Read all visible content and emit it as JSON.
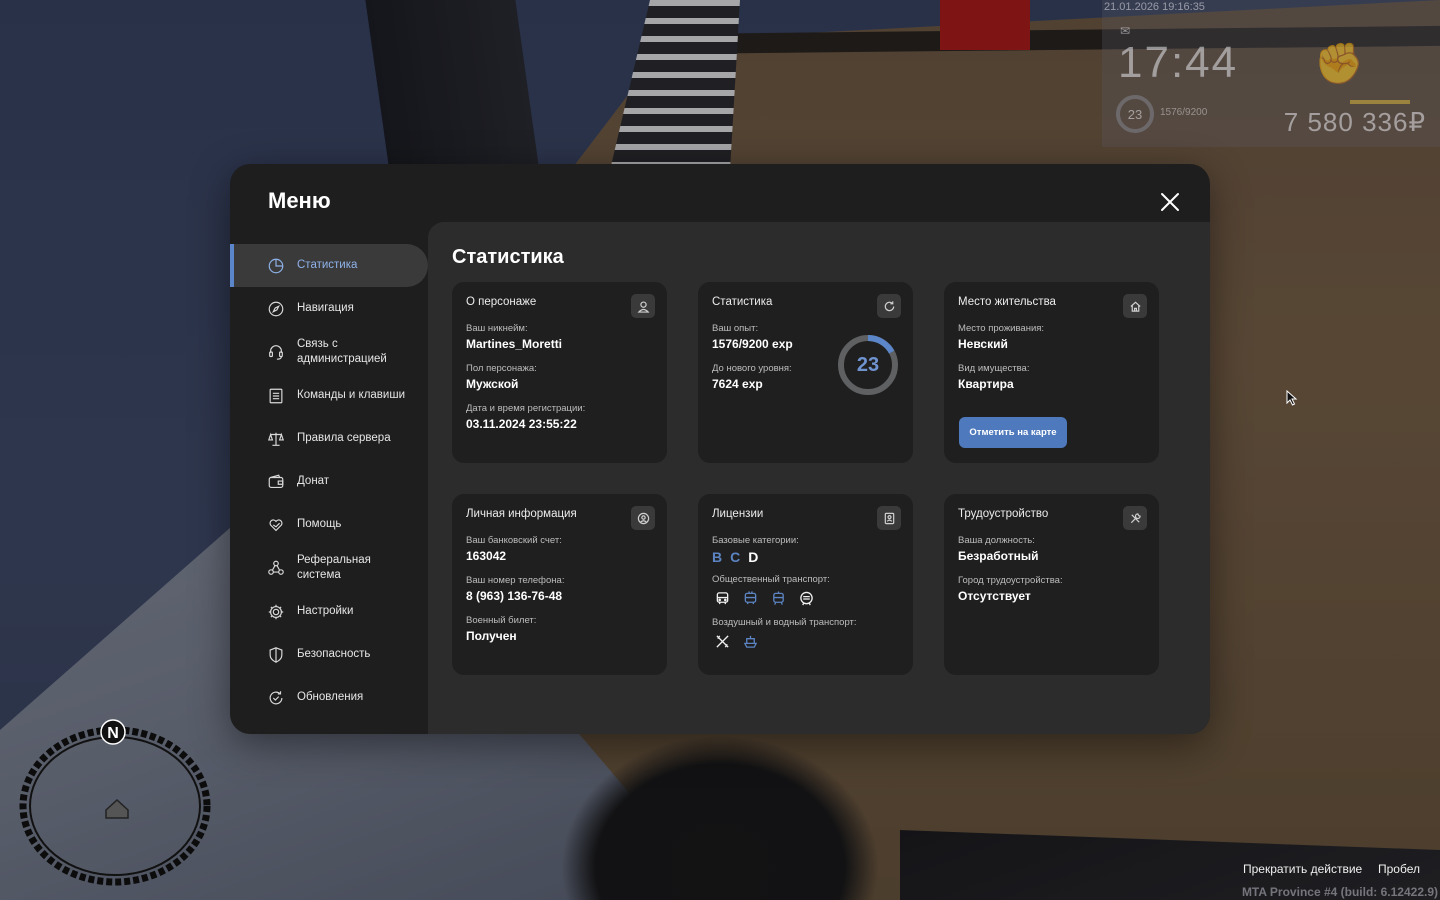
{
  "hud": {
    "datetime": "21.01.2026 19:16:35",
    "clock": "17:44",
    "level": "23",
    "exp": "1576/9200",
    "money": "7 580 336₽"
  },
  "menu": {
    "title": "Меню",
    "sidebar": [
      {
        "label": "Статистика",
        "icon": "chart-pie-icon",
        "active": true
      },
      {
        "label": "Навигация",
        "icon": "compass-icon"
      },
      {
        "label": "Связь с администрацией",
        "icon": "headset-icon"
      },
      {
        "label": "Команды и клавиши",
        "icon": "list-icon"
      },
      {
        "label": "Правила сервера",
        "icon": "scales-icon"
      },
      {
        "label": "Донат",
        "icon": "wallet-icon"
      },
      {
        "label": "Помощь",
        "icon": "heart-hand-icon"
      },
      {
        "label": "Реферальная система",
        "icon": "referral-icon"
      },
      {
        "label": "Настройки",
        "icon": "gear-icon"
      },
      {
        "label": "Безопасность",
        "icon": "shield-icon"
      },
      {
        "label": "Обновления",
        "icon": "refresh-check-icon"
      }
    ],
    "content_title": "Статистика",
    "cards": {
      "character": {
        "title": "О персонаже",
        "nickname_label": "Ваш никнейм:",
        "nickname": "Martines_Moretti",
        "gender_label": "Пол персонажа:",
        "gender": "Мужской",
        "reg_label": "Дата и время регистрации:",
        "reg": "03.11.2024 23:55:22"
      },
      "stats": {
        "title": "Статистика",
        "exp_label": "Ваш опыт:",
        "exp": "1576/9200 exp",
        "next_label": "До нового уровня:",
        "next": "7624 exp",
        "level": "23",
        "level_progress": 0.17
      },
      "residence": {
        "title": "Место жительства",
        "place_label": "Место проживания:",
        "place": "Невский",
        "property_label": "Вид имущества:",
        "property": "Квартира",
        "map_button": "Отметить на карте"
      },
      "personal": {
        "title": "Личная информация",
        "bank_label": "Ваш банковский счет:",
        "bank": "163042",
        "phone_label": "Ваш номер телефона:",
        "phone": "8 (963) 136-76-48",
        "military_label": "Военный билет:",
        "military": "Получен"
      },
      "licenses": {
        "title": "Лицензии",
        "base_label": "Базовые категории:",
        "categories": [
          {
            "name": "B",
            "owned": false
          },
          {
            "name": "C",
            "owned": false
          },
          {
            "name": "D",
            "owned": true
          }
        ],
        "public_label": "Общественный транспорт:",
        "public": [
          {
            "icon": "bus-icon",
            "owned": true
          },
          {
            "icon": "trolleybus-icon",
            "owned": false
          },
          {
            "icon": "tram-icon",
            "owned": false
          },
          {
            "icon": "metro-icon",
            "owned": true
          }
        ],
        "air_water_label": "Воздушный и водный транспорт:",
        "air_water": [
          {
            "icon": "plane-icon",
            "owned": true
          },
          {
            "icon": "boat-icon",
            "owned": false
          }
        ]
      },
      "job": {
        "title": "Трудоустройство",
        "position_label": "Ваша должность:",
        "position": "Безработный",
        "city_label": "Город трудоустройства:",
        "city": "Отсутствует"
      }
    }
  },
  "minimap": {
    "north": "N"
  },
  "hints": {
    "action": "Прекратить действие",
    "key": "Пробел"
  },
  "build": "MTA Province #4 (build: 6.12422.9)",
  "colors": {
    "accent": "#5b86c9",
    "panel": "#1e1e1e",
    "content": "#2c2c2c",
    "card": "#1f1f1f"
  }
}
